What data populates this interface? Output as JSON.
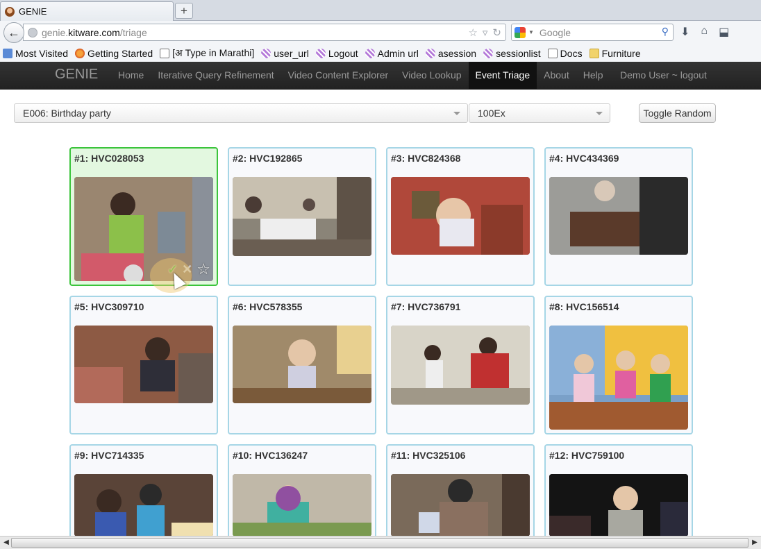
{
  "browser": {
    "tab_title": "GENIE",
    "new_tab_label": "+",
    "url_host": "genie.",
    "url_domain": "kitware.com",
    "url_path": "/triage",
    "search_placeholder": "Google",
    "bookmarks": [
      {
        "label": "Most Visited",
        "icon": "most-visited-icon"
      },
      {
        "label": "Getting Started",
        "icon": "firefox-icon"
      },
      {
        "label": "[अ Type in Marathi]",
        "icon": "page-icon"
      },
      {
        "label": "user_url",
        "icon": "bookmarklet-icon"
      },
      {
        "label": "Logout",
        "icon": "bookmarklet-icon"
      },
      {
        "label": "Admin url",
        "icon": "bookmarklet-icon"
      },
      {
        "label": "asession",
        "icon": "bookmarklet-icon"
      },
      {
        "label": "sessionlist",
        "icon": "bookmarklet-icon"
      },
      {
        "label": "Docs",
        "icon": "page-icon"
      },
      {
        "label": "Furniture",
        "icon": "folder-icon"
      }
    ]
  },
  "app": {
    "brand": "GENIE",
    "nav": [
      "Home",
      "Iterative Query Refinement",
      "Video Content Explorer",
      "Video Lookup",
      "Event Triage",
      "About",
      "Help"
    ],
    "active_nav": "Event Triage",
    "user": "Demo User ~ logout"
  },
  "controls": {
    "event_select": "E006: Birthday party",
    "example_select": "100Ex",
    "toggle_label": "Toggle Random"
  },
  "results": [
    {
      "title": "#1: HVC028053",
      "selected": true
    },
    {
      "title": "#2: HVC192865"
    },
    {
      "title": "#3: HVC824368"
    },
    {
      "title": "#4: HVC434369"
    },
    {
      "title": "#5: HVC309710"
    },
    {
      "title": "#6: HVC578355"
    },
    {
      "title": "#7: HVC736791"
    },
    {
      "title": "#8: HVC156514"
    },
    {
      "title": "#9: HVC714335"
    },
    {
      "title": "#10: HVC136247"
    },
    {
      "title": "#11: HVC325106"
    },
    {
      "title": "#12: HVC759100"
    }
  ],
  "colors": {
    "card_border": "#a6d6e6",
    "selected_border": "#3bc43b",
    "selected_bg": "#e3f8e0"
  }
}
